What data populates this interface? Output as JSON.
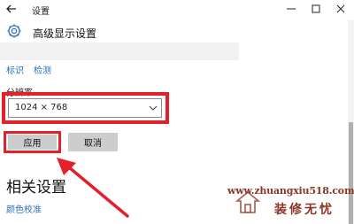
{
  "window": {
    "title": "设置"
  },
  "header": {
    "title": "高级显示设置"
  },
  "links": {
    "identify": "标识",
    "detect": "检测"
  },
  "resolution": {
    "label": "分辨率",
    "value": "1024 × 768"
  },
  "buttons": {
    "apply": "应用",
    "cancel": "取消"
  },
  "related": {
    "heading": "相关设置",
    "color_calibration": "颜色校准"
  },
  "watermark": {
    "url": "www.zhuangxiu518.com",
    "text": "装修无忧"
  },
  "colors": {
    "highlight": "#e4202a",
    "link": "#2f6fb7",
    "watermark": "#8c3526",
    "button": "#cdcdcd"
  },
  "icons": [
    "back-arrow-icon",
    "minimize-icon",
    "maximize-icon",
    "close-icon",
    "gear-icon",
    "chevron-down-icon",
    "red-arrow-icon",
    "watermark-logo-icon"
  ]
}
